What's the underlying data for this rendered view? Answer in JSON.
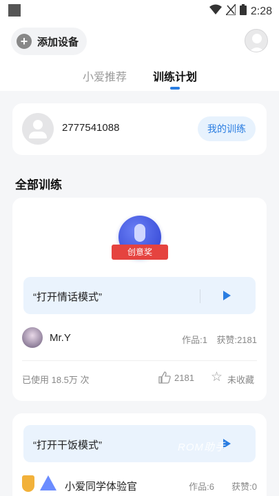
{
  "status_bar": {
    "time": "2:28"
  },
  "header": {
    "add_device_label": "添加设备",
    "tabs": [
      {
        "label": "小爱推荐",
        "active": false
      },
      {
        "label": "训练计划",
        "active": true
      }
    ]
  },
  "user_card": {
    "user_id": "2777541088",
    "my_training_label": "我的训练"
  },
  "section_title": "全部训练",
  "trainings": [
    {
      "badge_label": "创意奖",
      "command": "“打开情话模式”",
      "author": "Mr.Y",
      "works": "作品:1",
      "likes": "获赞:2181",
      "usage": "已使用 18.5万 次",
      "like_count": "2181",
      "favorite_label": "未收藏"
    },
    {
      "command": "“打开干饭模式”",
      "author": "小爱同学体验官",
      "works": "作品:6",
      "likes": "获赞:0",
      "watermark": "ROM助手"
    }
  ],
  "colors": {
    "accent": "#2a7de1",
    "command_bg": "#eaf3fd",
    "badge_ribbon": "#e5433f"
  }
}
